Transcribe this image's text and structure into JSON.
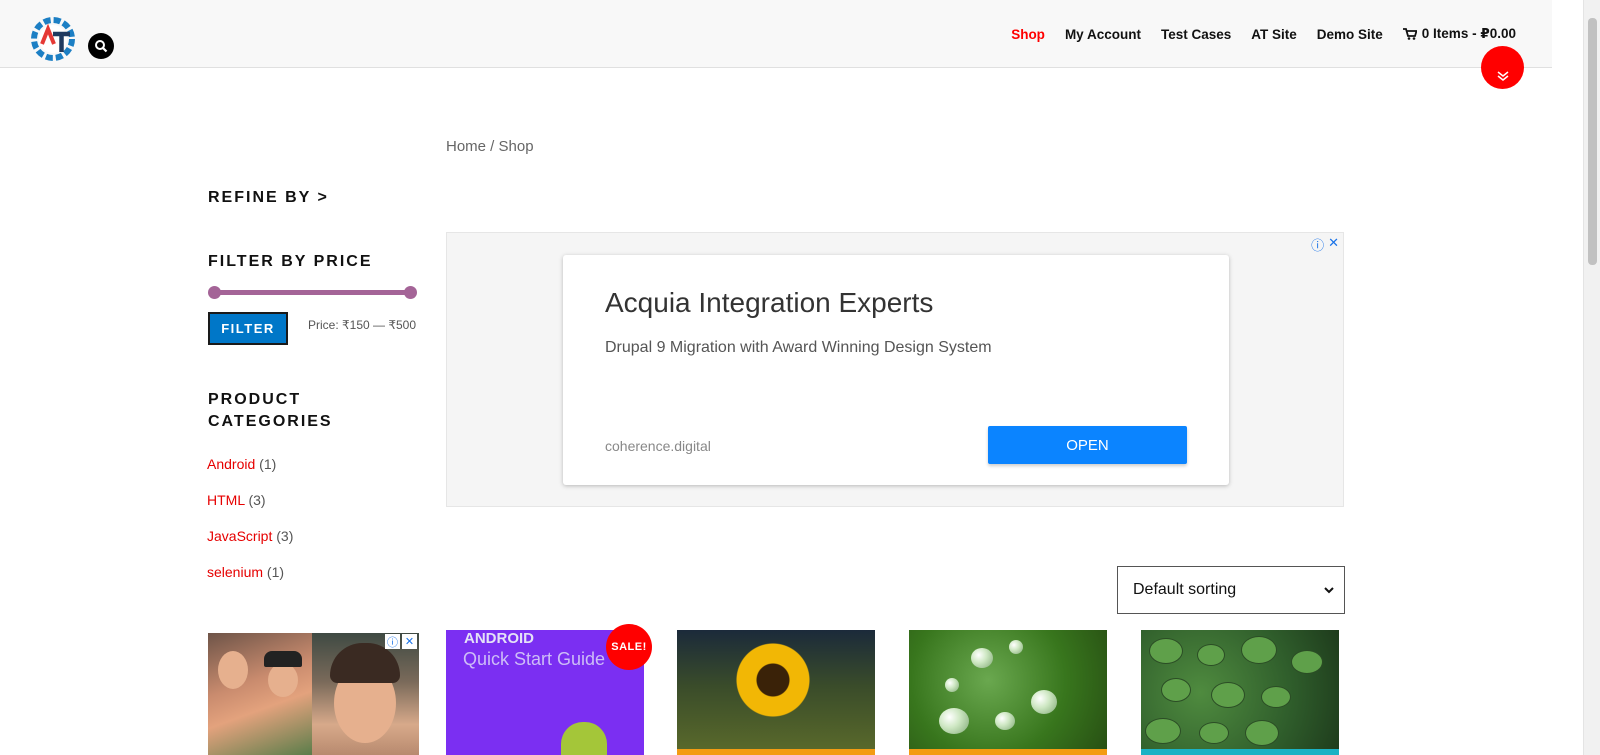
{
  "header": {
    "nav": [
      {
        "label": "Shop",
        "active": true
      },
      {
        "label": "My Account",
        "active": false
      },
      {
        "label": "Test Cases",
        "active": false
      },
      {
        "label": "AT Site",
        "active": false
      },
      {
        "label": "Demo Site",
        "active": false
      }
    ],
    "cart_label": "0 Items - ₽0.00",
    "logo_icon": "automation-testing-gear-logo",
    "search_icon": "search-icon",
    "accent_color": "#ff0000"
  },
  "breadcrumb": {
    "home": "Home",
    "separator": " / ",
    "current": "Shop"
  },
  "sidebar": {
    "refine_title": "REFINE BY >",
    "filter_price_title": "FILTER BY PRICE",
    "price_range": {
      "min": 150,
      "max": 500,
      "selected_min": 150,
      "selected_max": 500
    },
    "filter_button": "FILTER",
    "price_text": "Price: ₹150 — ₹500",
    "categories_title": "PRODUCT CATEGORIES",
    "categories": [
      {
        "name": "Android",
        "count": "(1)"
      },
      {
        "name": "HTML",
        "count": "(3)"
      },
      {
        "name": "JavaScript",
        "count": "(3)"
      },
      {
        "name": "selenium",
        "count": "(1)"
      }
    ]
  },
  "ad": {
    "title": "Acquia Integration Experts",
    "subtitle": "Drupal 9 Migration with Award Winning Design System",
    "domain": "coherence.digital",
    "cta": "OPEN",
    "adchoices_icons": [
      "info-icon",
      "close-icon"
    ]
  },
  "sorting": {
    "selected": "Default sorting"
  },
  "products": {
    "android_cover_line1": "ANDROID",
    "android_cover_line2": "Quick Start Guide",
    "sale_badge": "SALE!"
  }
}
